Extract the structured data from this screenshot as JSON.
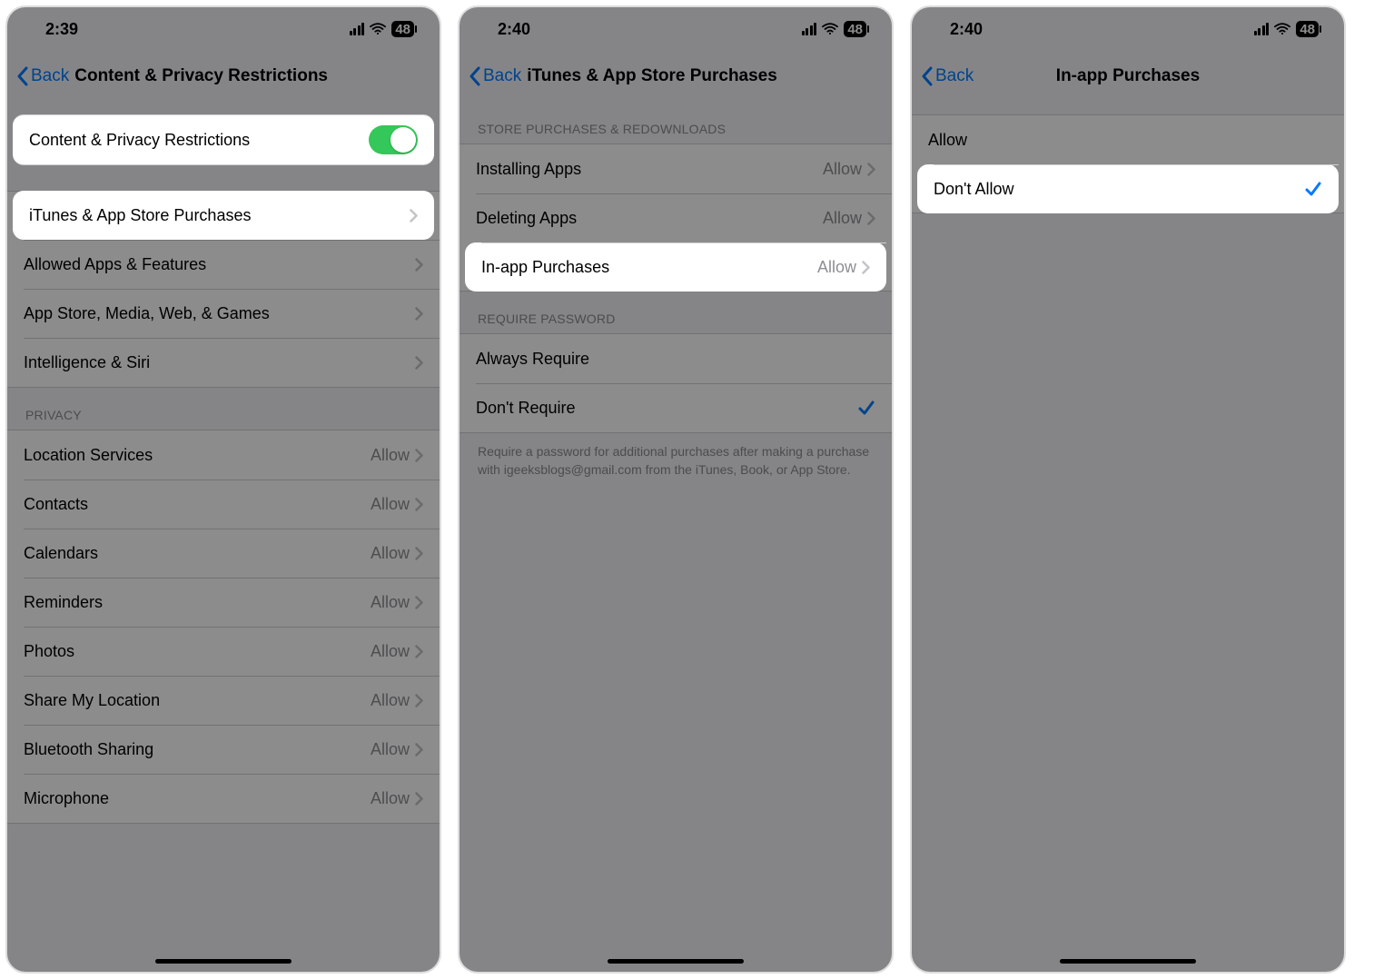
{
  "screens": [
    {
      "status": {
        "time": "2:39",
        "battery": "48"
      },
      "back_label": "Back",
      "title": "Content & Privacy Restrictions",
      "toggle_row": {
        "label": "Content & Privacy Restrictions",
        "on": true
      },
      "main_rows": [
        {
          "label": "iTunes & App Store Purchases"
        },
        {
          "label": "Allowed Apps & Features"
        },
        {
          "label": "App Store, Media, Web, & Games"
        },
        {
          "label": "Intelligence & Siri"
        }
      ],
      "privacy_header": "Privacy",
      "privacy_rows": [
        {
          "label": "Location Services",
          "value": "Allow"
        },
        {
          "label": "Contacts",
          "value": "Allow"
        },
        {
          "label": "Calendars",
          "value": "Allow"
        },
        {
          "label": "Reminders",
          "value": "Allow"
        },
        {
          "label": "Photos",
          "value": "Allow"
        },
        {
          "label": "Share My Location",
          "value": "Allow"
        },
        {
          "label": "Bluetooth Sharing",
          "value": "Allow"
        },
        {
          "label": "Microphone",
          "value": "Allow"
        }
      ]
    },
    {
      "status": {
        "time": "2:40",
        "battery": "48"
      },
      "back_label": "Back",
      "title": "iTunes & App Store Purchases",
      "store_header": "Store Purchases & Redownloads",
      "store_rows": [
        {
          "label": "Installing Apps",
          "value": "Allow"
        },
        {
          "label": "Deleting Apps",
          "value": "Allow"
        },
        {
          "label": "In-app Purchases",
          "value": "Allow"
        }
      ],
      "password_header": "Require Password",
      "password_rows": [
        {
          "label": "Always Require",
          "checked": false
        },
        {
          "label": "Don't Require",
          "checked": true
        }
      ],
      "footer": "Require a password for additional purchases after making a purchase with igeeksblogs@gmail.com from the iTunes, Book, or App Store."
    },
    {
      "status": {
        "time": "2:40",
        "battery": "48"
      },
      "back_label": "Back",
      "title": "In-app Purchases",
      "options": [
        {
          "label": "Allow",
          "checked": false
        },
        {
          "label": "Don't Allow",
          "checked": true
        }
      ]
    }
  ]
}
